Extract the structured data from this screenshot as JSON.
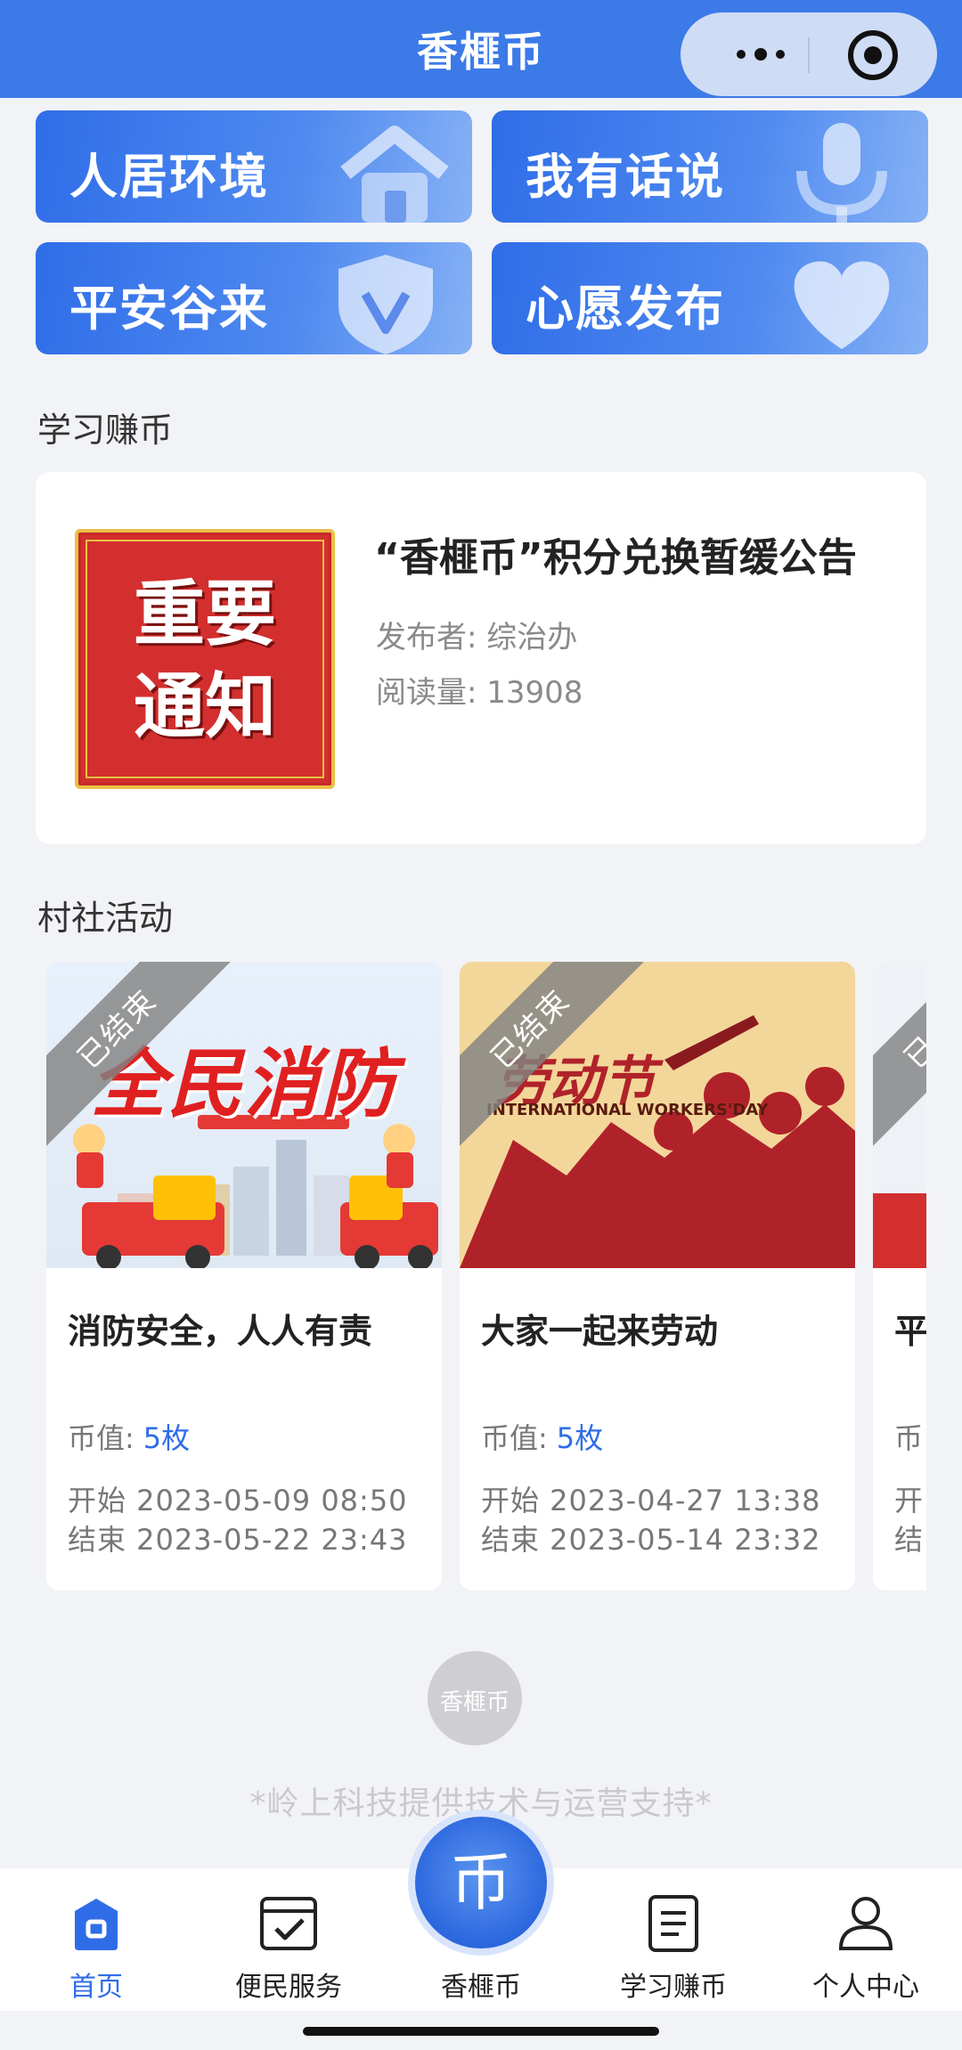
{
  "header": {
    "title": "香榧币"
  },
  "tiles": [
    {
      "label": "人居环境",
      "icon": "house-icon"
    },
    {
      "label": "我有话说",
      "icon": "microphone-icon"
    },
    {
      "label": "平安谷来",
      "icon": "shield-icon"
    },
    {
      "label": "心愿发布",
      "icon": "heart-icon"
    }
  ],
  "study": {
    "section_title": "学习赚币",
    "article": {
      "image_text_line1": "重要",
      "image_text_line2": "通知",
      "title": "“香榧币”积分兑换暂缓公告",
      "publisher": "发布者: 综治办",
      "reads": "阅读量: 13908"
    }
  },
  "activities": {
    "section_title": "村社活动",
    "status_label": "已结束",
    "coin_label": "币值:",
    "items": [
      {
        "banner_text": "全民消防",
        "title": "消防安全，人人有责",
        "coin": "5枚",
        "start": "开始 2023-05-09 08:50",
        "end": "结束 2023-05-22 23:43"
      },
      {
        "banner_text": "劳动节",
        "banner_sub": "INTERNATIONAL WORKERS'DAY",
        "title": "大家一起来劳动",
        "coin": "5枚",
        "start": "开始 2023-04-27 13:38",
        "end": "结束 2023-05-14 23:32"
      },
      {
        "title": "平",
        "coin_partial": "币",
        "start": "开",
        "end": "结"
      }
    ]
  },
  "footer": {
    "logo_text": "香榧币",
    "support_text": "*岭上科技提供技术与运营支持*"
  },
  "tabbar": {
    "items": [
      {
        "label": "首页",
        "icon": "home-icon",
        "active": true
      },
      {
        "label": "便民服务",
        "icon": "check-board-icon",
        "active": false
      },
      {
        "label": "香榧币",
        "icon": "coin-icon",
        "active": false
      },
      {
        "label": "学习赚币",
        "icon": "document-icon",
        "active": false
      },
      {
        "label": "个人中心",
        "icon": "user-icon",
        "active": false
      }
    ],
    "center_glyph": "币"
  },
  "colors": {
    "primary": "#2f6de8",
    "header": "#3c7ae8",
    "notice_red": "#d32f2f"
  }
}
